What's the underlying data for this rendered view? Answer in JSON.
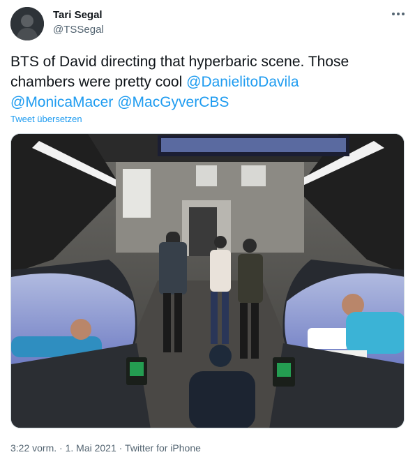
{
  "author": {
    "name": "Tari Segal",
    "handle": "@TSSegal",
    "avatar_icon": "profile-avatar"
  },
  "menu": {
    "icon": "more-horizontal-icon"
  },
  "tweet": {
    "text_plain": "BTS of David directing that hyperbaric scene. Those chambers were pretty cool",
    "mentions": [
      "@DanielitoDavila",
      "@MonicaMacer",
      "@MacGyverCBS"
    ],
    "translate_label": "Tweet übersetzen"
  },
  "media": {
    "icon": "photo-image"
  },
  "meta": {
    "time": "3:22 vorm.",
    "separator1": "·",
    "date": "1. Mai 2021",
    "separator2": "·",
    "source": "Twitter for iPhone"
  },
  "colors": {
    "link": "#1d9bf0",
    "text": "#0f1419",
    "secondary": "#536471"
  }
}
